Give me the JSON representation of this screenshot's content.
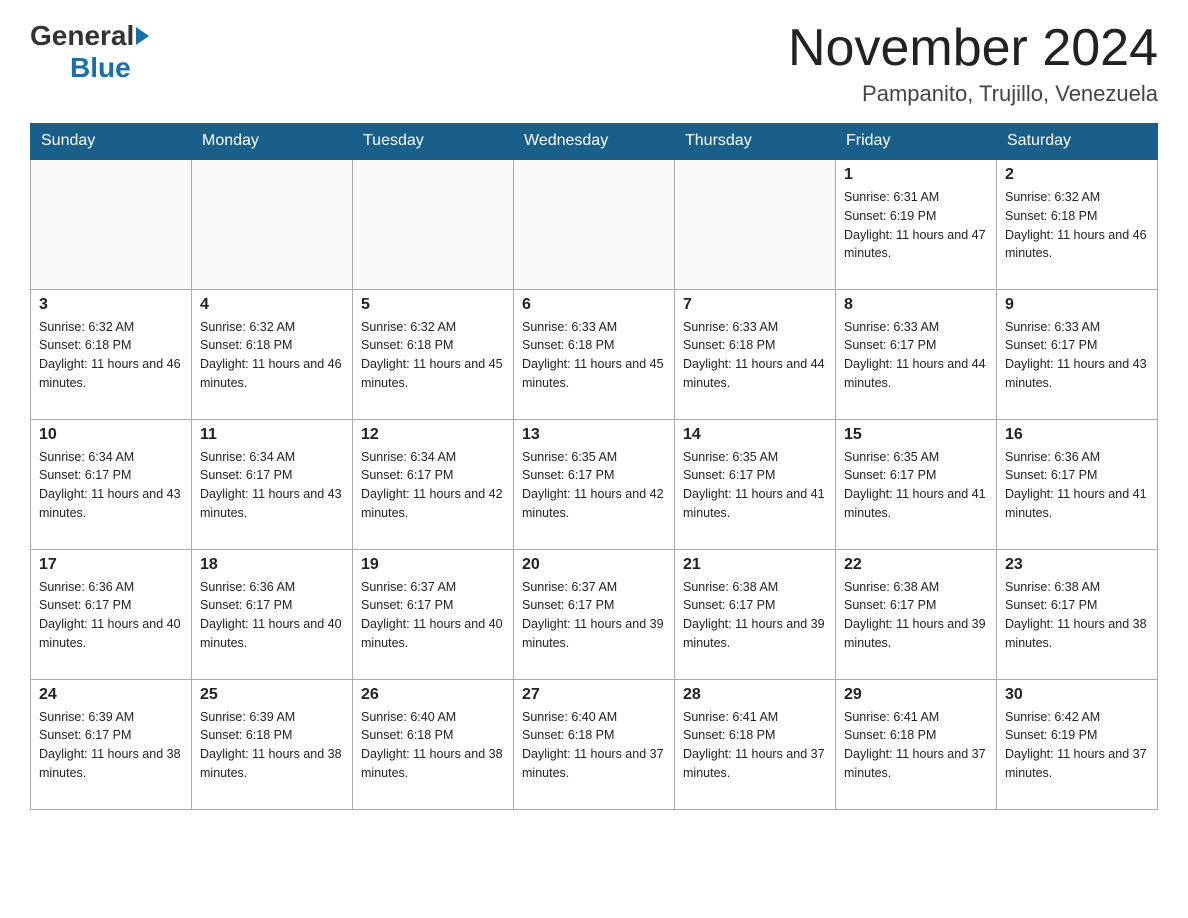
{
  "header": {
    "logo_general": "General",
    "logo_blue": "Blue",
    "month_title": "November 2024",
    "location": "Pampanito, Trujillo, Venezuela"
  },
  "days_of_week": [
    "Sunday",
    "Monday",
    "Tuesday",
    "Wednesday",
    "Thursday",
    "Friday",
    "Saturday"
  ],
  "weeks": [
    [
      {
        "day": "",
        "info": ""
      },
      {
        "day": "",
        "info": ""
      },
      {
        "day": "",
        "info": ""
      },
      {
        "day": "",
        "info": ""
      },
      {
        "day": "",
        "info": ""
      },
      {
        "day": "1",
        "info": "Sunrise: 6:31 AM\nSunset: 6:19 PM\nDaylight: 11 hours and 47 minutes."
      },
      {
        "day": "2",
        "info": "Sunrise: 6:32 AM\nSunset: 6:18 PM\nDaylight: 11 hours and 46 minutes."
      }
    ],
    [
      {
        "day": "3",
        "info": "Sunrise: 6:32 AM\nSunset: 6:18 PM\nDaylight: 11 hours and 46 minutes."
      },
      {
        "day": "4",
        "info": "Sunrise: 6:32 AM\nSunset: 6:18 PM\nDaylight: 11 hours and 46 minutes."
      },
      {
        "day": "5",
        "info": "Sunrise: 6:32 AM\nSunset: 6:18 PM\nDaylight: 11 hours and 45 minutes."
      },
      {
        "day": "6",
        "info": "Sunrise: 6:33 AM\nSunset: 6:18 PM\nDaylight: 11 hours and 45 minutes."
      },
      {
        "day": "7",
        "info": "Sunrise: 6:33 AM\nSunset: 6:18 PM\nDaylight: 11 hours and 44 minutes."
      },
      {
        "day": "8",
        "info": "Sunrise: 6:33 AM\nSunset: 6:17 PM\nDaylight: 11 hours and 44 minutes."
      },
      {
        "day": "9",
        "info": "Sunrise: 6:33 AM\nSunset: 6:17 PM\nDaylight: 11 hours and 43 minutes."
      }
    ],
    [
      {
        "day": "10",
        "info": "Sunrise: 6:34 AM\nSunset: 6:17 PM\nDaylight: 11 hours and 43 minutes."
      },
      {
        "day": "11",
        "info": "Sunrise: 6:34 AM\nSunset: 6:17 PM\nDaylight: 11 hours and 43 minutes."
      },
      {
        "day": "12",
        "info": "Sunrise: 6:34 AM\nSunset: 6:17 PM\nDaylight: 11 hours and 42 minutes."
      },
      {
        "day": "13",
        "info": "Sunrise: 6:35 AM\nSunset: 6:17 PM\nDaylight: 11 hours and 42 minutes."
      },
      {
        "day": "14",
        "info": "Sunrise: 6:35 AM\nSunset: 6:17 PM\nDaylight: 11 hours and 41 minutes."
      },
      {
        "day": "15",
        "info": "Sunrise: 6:35 AM\nSunset: 6:17 PM\nDaylight: 11 hours and 41 minutes."
      },
      {
        "day": "16",
        "info": "Sunrise: 6:36 AM\nSunset: 6:17 PM\nDaylight: 11 hours and 41 minutes."
      }
    ],
    [
      {
        "day": "17",
        "info": "Sunrise: 6:36 AM\nSunset: 6:17 PM\nDaylight: 11 hours and 40 minutes."
      },
      {
        "day": "18",
        "info": "Sunrise: 6:36 AM\nSunset: 6:17 PM\nDaylight: 11 hours and 40 minutes."
      },
      {
        "day": "19",
        "info": "Sunrise: 6:37 AM\nSunset: 6:17 PM\nDaylight: 11 hours and 40 minutes."
      },
      {
        "day": "20",
        "info": "Sunrise: 6:37 AM\nSunset: 6:17 PM\nDaylight: 11 hours and 39 minutes."
      },
      {
        "day": "21",
        "info": "Sunrise: 6:38 AM\nSunset: 6:17 PM\nDaylight: 11 hours and 39 minutes."
      },
      {
        "day": "22",
        "info": "Sunrise: 6:38 AM\nSunset: 6:17 PM\nDaylight: 11 hours and 39 minutes."
      },
      {
        "day": "23",
        "info": "Sunrise: 6:38 AM\nSunset: 6:17 PM\nDaylight: 11 hours and 38 minutes."
      }
    ],
    [
      {
        "day": "24",
        "info": "Sunrise: 6:39 AM\nSunset: 6:17 PM\nDaylight: 11 hours and 38 minutes."
      },
      {
        "day": "25",
        "info": "Sunrise: 6:39 AM\nSunset: 6:18 PM\nDaylight: 11 hours and 38 minutes."
      },
      {
        "day": "26",
        "info": "Sunrise: 6:40 AM\nSunset: 6:18 PM\nDaylight: 11 hours and 38 minutes."
      },
      {
        "day": "27",
        "info": "Sunrise: 6:40 AM\nSunset: 6:18 PM\nDaylight: 11 hours and 37 minutes."
      },
      {
        "day": "28",
        "info": "Sunrise: 6:41 AM\nSunset: 6:18 PM\nDaylight: 11 hours and 37 minutes."
      },
      {
        "day": "29",
        "info": "Sunrise: 6:41 AM\nSunset: 6:18 PM\nDaylight: 11 hours and 37 minutes."
      },
      {
        "day": "30",
        "info": "Sunrise: 6:42 AM\nSunset: 6:19 PM\nDaylight: 11 hours and 37 minutes."
      }
    ]
  ]
}
